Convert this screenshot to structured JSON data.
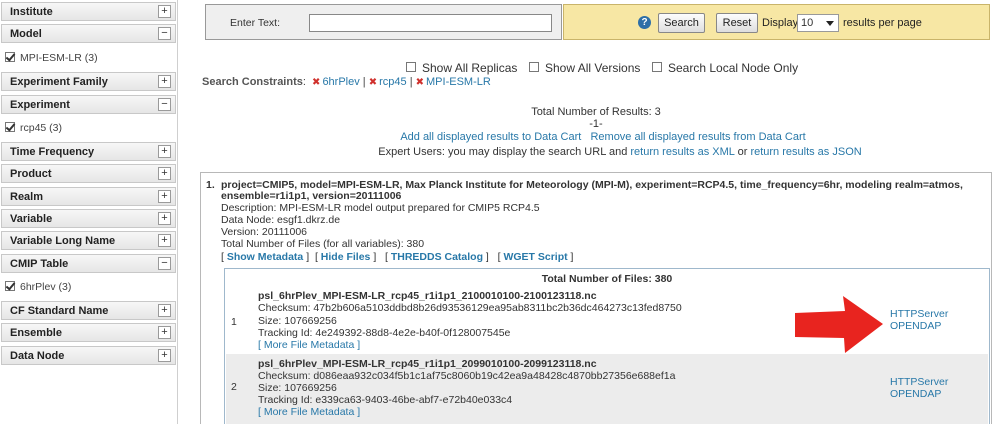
{
  "sidebar": {
    "facets": [
      {
        "label": "Institute",
        "toggle": "+"
      },
      {
        "label": "Model",
        "toggle": "−",
        "selected": "MPI-ESM-LR (3)"
      },
      {
        "label": "Experiment Family",
        "toggle": "+"
      },
      {
        "label": "Experiment",
        "toggle": "−",
        "selected": "rcp45 (3)"
      },
      {
        "label": "Time Frequency",
        "toggle": "+"
      },
      {
        "label": "Product",
        "toggle": "+"
      },
      {
        "label": "Realm",
        "toggle": "+"
      },
      {
        "label": "Variable",
        "toggle": "+"
      },
      {
        "label": "Variable Long Name",
        "toggle": "+"
      },
      {
        "label": "CMIP Table",
        "toggle": "−",
        "selected": "6hrPlev (3)"
      },
      {
        "label": "CF Standard Name",
        "toggle": "+"
      },
      {
        "label": "Ensemble",
        "toggle": "+"
      },
      {
        "label": "Data Node",
        "toggle": "+"
      }
    ]
  },
  "search": {
    "enter_text_label": "Enter Text:",
    "value": "",
    "help_icon": "?",
    "search_label": "Search",
    "reset_label": "Reset",
    "display_label": "Display",
    "per_page_value": "10",
    "results_per_page_label": "results per page"
  },
  "options": {
    "show_replicas": "Show All Replicas",
    "show_versions": "Show All Versions",
    "search_local": "Search Local Node Only"
  },
  "constraints": {
    "label": "Search Constraints",
    "items": [
      "6hrPlev",
      "rcp45",
      "MPI-ESM-LR"
    ]
  },
  "summary": {
    "total": "Total Number of Results: 3",
    "page": "-1-",
    "add_all": "Add all displayed results to Data Cart",
    "remove_all": "Remove all displayed results from Data Cart",
    "expert_prefix": "Expert Users: you may display the search URL and",
    "xml_link": "return results as XML",
    "or": "or",
    "json_link": "return results as JSON"
  },
  "result": {
    "number": "1.",
    "title_line1": "project=CMIP5, model=MPI-ESM-LR, Max Planck Institute for Meteorology (MPI-M), experiment=RCP4.5, time_frequency=6hr, modeling realm=atmos,",
    "title_line2": "ensemble=r1i1p1, version=20111006",
    "description": "Description: MPI-ESM-LR model output prepared for CMIP5 RCP4.5",
    "data_node": "Data Node: esgf1.dkrz.de",
    "version": "Version: 20111006",
    "total_files_vars": "Total Number of Files (for all variables): 380",
    "links": [
      "Show Metadata",
      "Hide Files",
      "THREDDS Catalog",
      "WGET Script"
    ],
    "files_header": "Total Number of Files: 380",
    "files": [
      {
        "index": "1",
        "name": "psl_6hrPlev_MPI-ESM-LR_rcp45_r1i1p1_2100010100-2100123118.nc",
        "checksum": "Checksum: 47b2b606a5103ddbd8b26d93536129ea95ab8311bc2b36dc464273c13fed8750",
        "size": "Size: 107669256",
        "tracking": "Tracking Id: 4e249392-88d8-4e2e-b40f-0f128007545e",
        "more": "[ More File Metadata ]",
        "services": [
          "HTTPServer",
          "OPENDAP"
        ]
      },
      {
        "index": "2",
        "name": "psl_6hrPlev_MPI-ESM-LR_rcp45_r1i1p1_2099010100-2099123118.nc",
        "checksum": "Checksum: d086eaa932c034f5b1c1af75c8060b19c42ea9a48428c4870bb27356e688ef1a",
        "size": "Size: 107669256",
        "tracking": "Tracking Id: e339ca63-9403-46be-abf7-e72b40e033c4",
        "more": "[ More File Metadata ]",
        "services": [
          "HTTPServer",
          "OPENDAP"
        ]
      }
    ]
  },
  "colors": {
    "link": "#2878a8",
    "arrow": "#e8241f",
    "control_bg": "#f7e7a4"
  }
}
